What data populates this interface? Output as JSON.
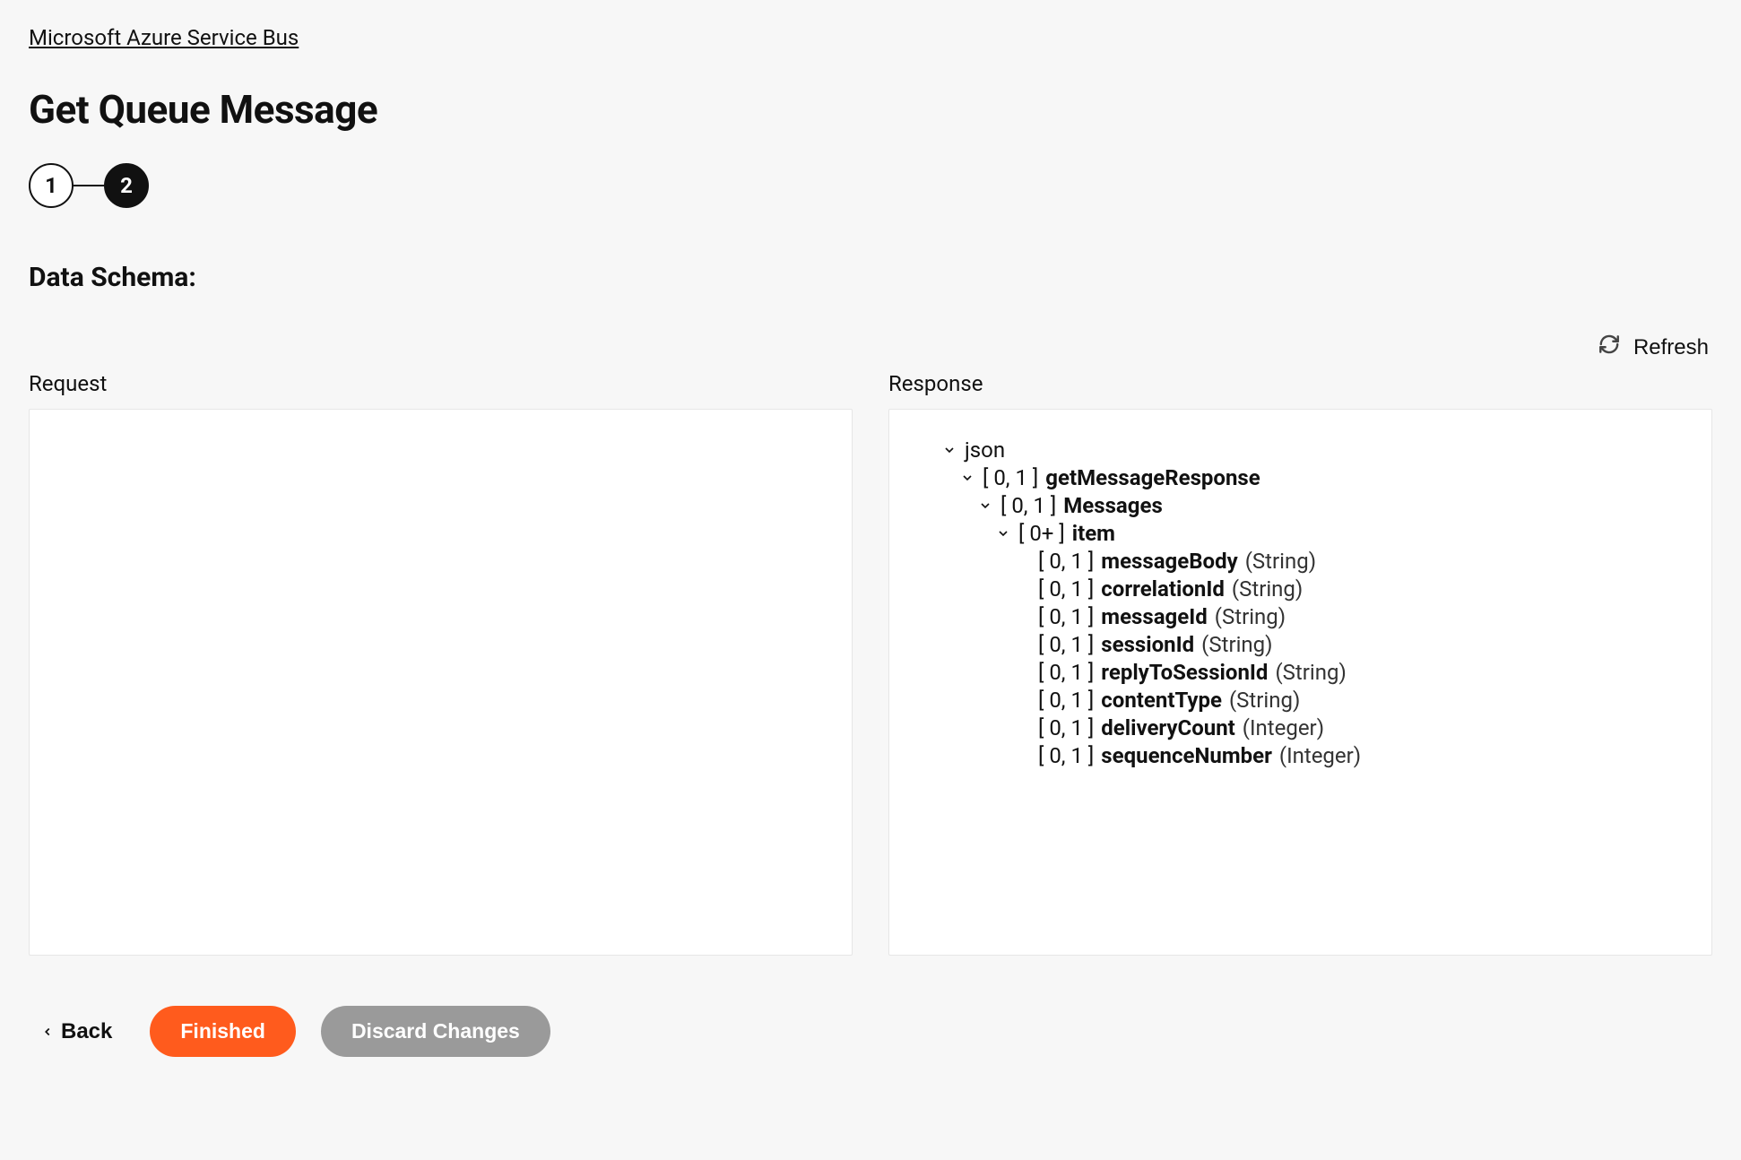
{
  "breadcrumb": "Microsoft Azure Service Bus",
  "page_title": "Get Queue Message",
  "stepper": {
    "step1": "1",
    "step2": "2"
  },
  "section_title": "Data Schema:",
  "refresh_label": "Refresh",
  "request_label": "Request",
  "response_label": "Response",
  "tree": {
    "root": {
      "name": "json"
    },
    "n1": {
      "card": "[ 0, 1 ]",
      "name": "getMessageResponse"
    },
    "n2": {
      "card": "[ 0, 1 ]",
      "name": "Messages"
    },
    "n3": {
      "card": "[ 0+ ]",
      "name": "item"
    },
    "leaves": [
      {
        "card": "[ 0, 1 ]",
        "name": "messageBody",
        "type": "(String)"
      },
      {
        "card": "[ 0, 1 ]",
        "name": "correlationId",
        "type": "(String)"
      },
      {
        "card": "[ 0, 1 ]",
        "name": "messageId",
        "type": "(String)"
      },
      {
        "card": "[ 0, 1 ]",
        "name": "sessionId",
        "type": "(String)"
      },
      {
        "card": "[ 0, 1 ]",
        "name": "replyToSessionId",
        "type": "(String)"
      },
      {
        "card": "[ 0, 1 ]",
        "name": "contentType",
        "type": "(String)"
      },
      {
        "card": "[ 0, 1 ]",
        "name": "deliveryCount",
        "type": "(Integer)"
      },
      {
        "card": "[ 0, 1 ]",
        "name": "sequenceNumber",
        "type": "(Integer)"
      }
    ]
  },
  "footer": {
    "back": "Back",
    "finished": "Finished",
    "discard": "Discard Changes"
  }
}
